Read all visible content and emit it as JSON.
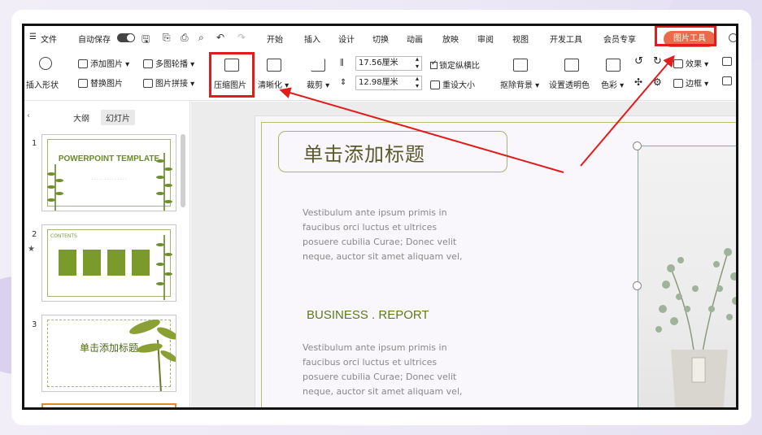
{
  "menu": {
    "file": "文件",
    "autosave": "自动保存",
    "tabs": [
      "开始",
      "插入",
      "设计",
      "切换",
      "动画",
      "放映",
      "审阅",
      "视图",
      "开发工具",
      "会员专享"
    ],
    "active_tab": "图片工具"
  },
  "toolbar": {
    "insert_shape": "插入形状",
    "add_picture": "添加图片",
    "replace_picture": "替换图片",
    "multi_outline": "多图轮播",
    "picture_collage": "图片拼接",
    "compress_picture": "压缩图片",
    "sharpen": "清晰化",
    "crop": "裁剪",
    "width_value": "17.56厘米",
    "height_value": "12.98厘米",
    "lock_ratio": "锁定纵横比",
    "reset_size": "重设大小",
    "remove_background": "抠除背景",
    "set_transparent": "设置透明色",
    "color": "色彩",
    "effects": "效果",
    "border": "边框"
  },
  "panel": {
    "tab_outline": "大纲",
    "tab_slides": "幻灯片",
    "slides": [
      {
        "num": "1",
        "title": "POWERPOINT TEMPLATE"
      },
      {
        "num": "2",
        "label": "CONTENTS"
      },
      {
        "num": "3",
        "title": "单击添加标题"
      }
    ]
  },
  "slide": {
    "title": "单击添加标题",
    "paragraph1": "Vestibulum ante ipsum primis in faucibus orci luctus et ultrices posuere cubilia Curae; Donec velit neque, auctor sit amet aliquam vel,",
    "heading": "BUSINESS . REPORT",
    "paragraph2": "Vestibulum ante ipsum primis in faucibus orci luctus et ultrices posuere cubilia Curae; Donec velit neque, auctor sit amet aliquam vel,"
  },
  "colors": {
    "accent": "#ea6a49",
    "highlight_red": "#e21b1b",
    "slide_green": "#5f7b16"
  }
}
